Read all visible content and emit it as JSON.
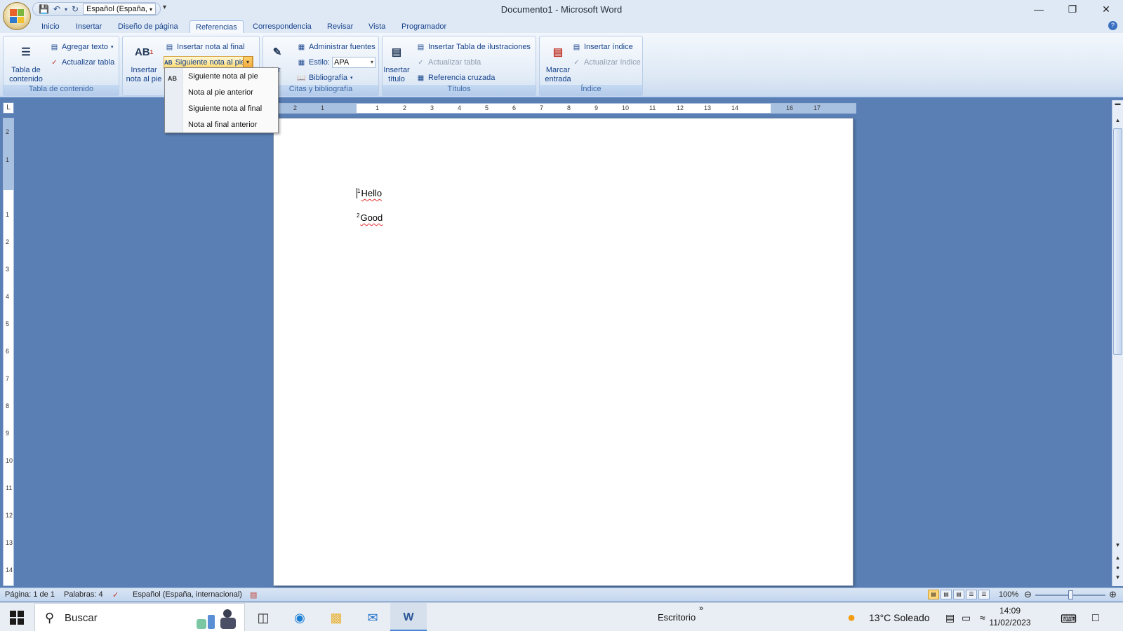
{
  "app": {
    "window_title": "Documento1 - Microsoft Word",
    "qat_language": "Español (España,",
    "tabs": [
      "Inicio",
      "Insertar",
      "Diseño de página",
      "Referencias",
      "Correspondencia",
      "Revisar",
      "Vista",
      "Programador"
    ],
    "active_tab": "Referencias"
  },
  "ribbon": {
    "toc": {
      "big_label_1": "Tabla de",
      "big_label_2": "contenido",
      "add_text": "Agregar texto",
      "update_table": "Actualizar tabla",
      "group": "Tabla de contenido"
    },
    "footnotes": {
      "insert_footnote_1": "Insertar",
      "insert_footnote_2": "nota al pie",
      "insert_endnote": "Insertar nota al final",
      "next_footnote": "Siguiente nota al pie"
    },
    "citations": {
      "insert_cut_1": "rtar",
      "insert_cut_2": "a",
      "manage_sources": "Administrar fuentes",
      "style_label": "Estilo:",
      "style_value": "APA",
      "bibliography": "Bibliografía",
      "group": "Citas y bibliografía"
    },
    "captions": {
      "insert_caption_1": "Insertar",
      "insert_caption_2": "título",
      "insert_table_figures": "Insertar Tabla de ilustraciones",
      "update_table": "Actualizar tabla",
      "cross_reference": "Referencia cruzada",
      "group": "Títulos"
    },
    "index": {
      "mark_entry_1": "Marcar",
      "mark_entry_2": "entrada",
      "insert_index": "Insertar índice",
      "update_index": "Actualizar índice",
      "group": "Índice"
    }
  },
  "dropdown": {
    "items": [
      "Siguiente nota al pie",
      "Nota al pie anterior",
      "Siguiente nota al final",
      "Nota al final anterior"
    ]
  },
  "document": {
    "lines": [
      {
        "sup": "1",
        "text": "Hello"
      },
      {
        "sup": "2",
        "text": "Good"
      }
    ]
  },
  "status": {
    "page": "Página: 1 de 1",
    "words": "Palabras: 4",
    "language": "Español (España, internacional)",
    "zoom": "100%"
  },
  "taskbar": {
    "search": "Buscar",
    "desktop": "Escritorio",
    "weather": "13°C  Soleado",
    "time": "14:09",
    "date": "11/02/2023"
  },
  "ruler": {
    "h_ticks": [
      "2",
      "1",
      "1",
      "2",
      "3",
      "4",
      "5",
      "6",
      "7",
      "8",
      "9",
      "10",
      "11",
      "12",
      "13",
      "14",
      "16",
      "17"
    ],
    "v_ticks": [
      "2",
      "1",
      "1",
      "2",
      "3",
      "4",
      "5",
      "6",
      "7",
      "8",
      "9",
      "10",
      "11",
      "12",
      "13",
      "14"
    ]
  },
  "colors": {
    "ribbon_accent": "#15428b",
    "selected_button": "#ffd96e",
    "spell_squiggle": "#e03030"
  }
}
